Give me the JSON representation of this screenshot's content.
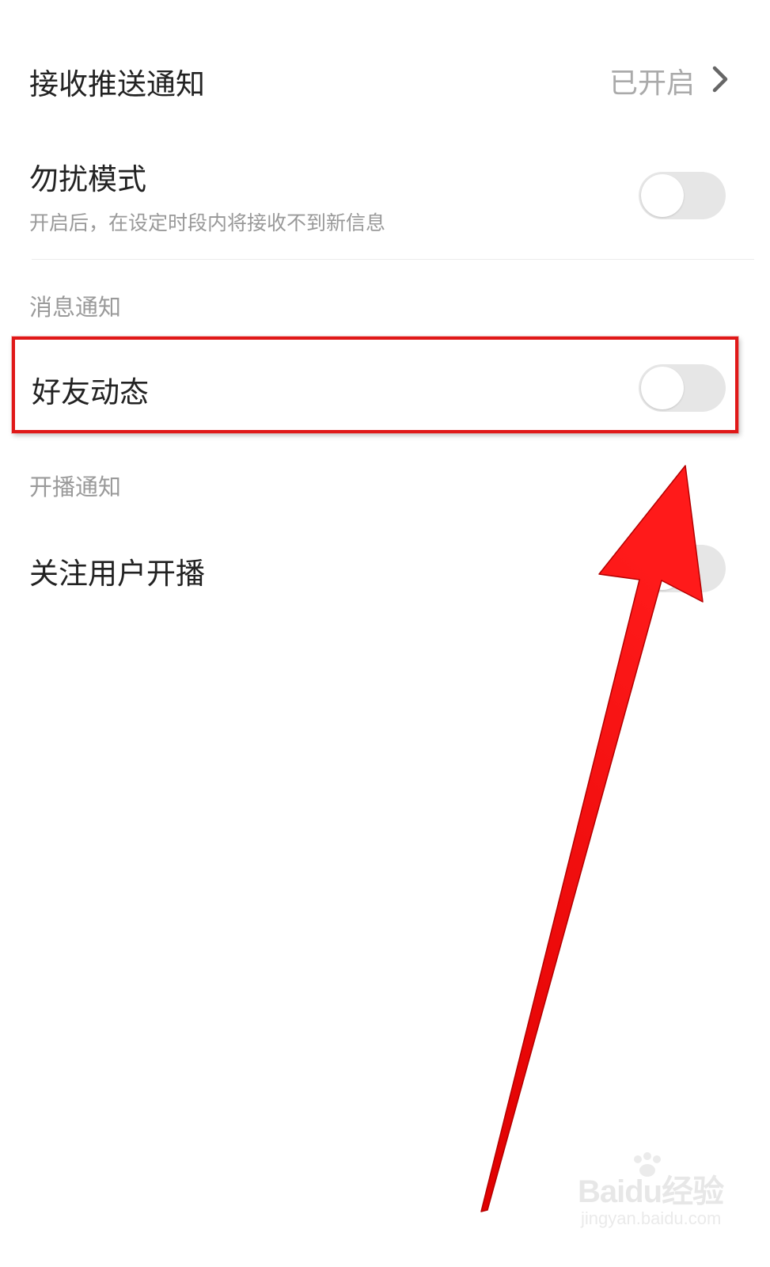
{
  "push_notification": {
    "label": "接收推送通知",
    "status": "已开启"
  },
  "dnd_mode": {
    "label": "勿扰模式",
    "description": "开启后，在设定时段内将接收不到新信息",
    "enabled": false
  },
  "message_section": {
    "header": "消息通知",
    "friend_activity": {
      "label": "好友动态",
      "enabled": false
    }
  },
  "broadcast_section": {
    "header": "开播通知",
    "followed_users_live": {
      "label": "关注用户开播",
      "enabled": false
    }
  },
  "annotation": {
    "highlight_color": "#e01818",
    "arrow_color": "#ff0000"
  },
  "watermark": {
    "logo": "Baidu经验",
    "url": "jingyan.baidu.com"
  }
}
